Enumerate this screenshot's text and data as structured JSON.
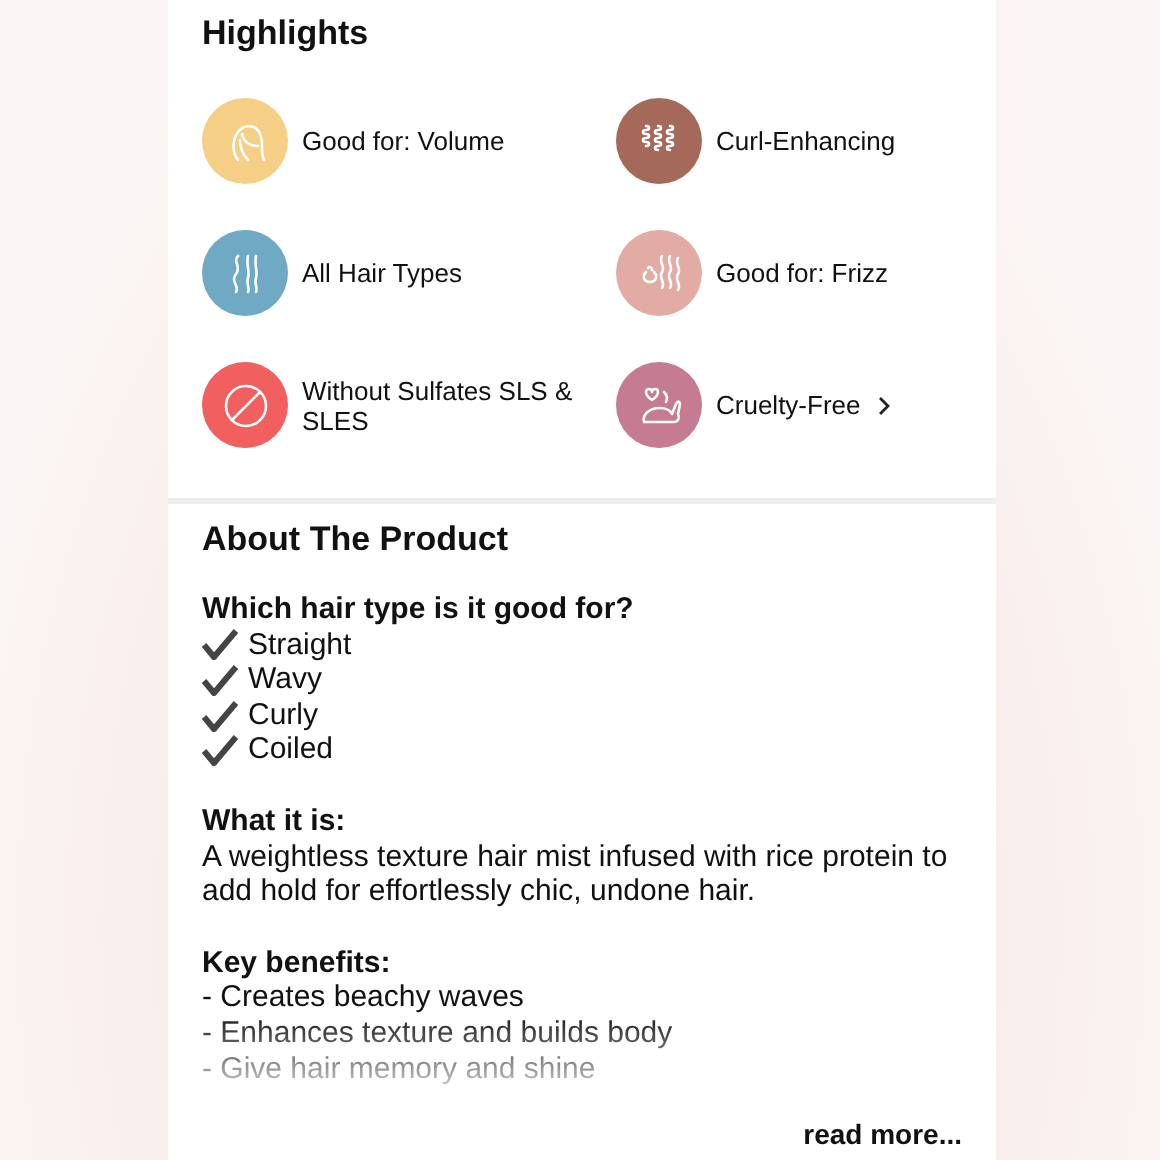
{
  "highlights": {
    "title": "Highlights",
    "items": [
      {
        "label": "Good for: Volume",
        "color": "#f6cf87",
        "link": false
      },
      {
        "label": "Curl-Enhancing",
        "color": "#a5695a",
        "link": false
      },
      {
        "label": "All Hair Types",
        "color": "#6fa9c4",
        "link": false
      },
      {
        "label": "Good for: Frizz",
        "color": "#e2aca5",
        "link": false
      },
      {
        "label": "Without Sulfates SLS & SLES",
        "color": "#f25f5f",
        "link": false
      },
      {
        "label": "Cruelty-Free",
        "color": "#c57b92",
        "link": true
      }
    ]
  },
  "about": {
    "title": "About The Product",
    "hair_types": {
      "heading": "Which hair type is it good for?",
      "items": [
        {
          "label": "Straight",
          "checked": true
        },
        {
          "label": "Wavy",
          "checked": true
        },
        {
          "label": "Curly",
          "checked": true
        },
        {
          "label": "Coiled",
          "checked": true
        }
      ]
    },
    "what_it_is": {
      "heading": "What it is:",
      "text": "A weightless texture hair mist infused with rice protein to add hold for effortlessly chic, undone hair."
    },
    "key_benefits": {
      "heading": "Key benefits:",
      "lines": [
        "- Creates beachy waves",
        "- Enhances texture and builds body",
        "- Give hair memory and shine"
      ]
    },
    "read_more": "read more..."
  }
}
